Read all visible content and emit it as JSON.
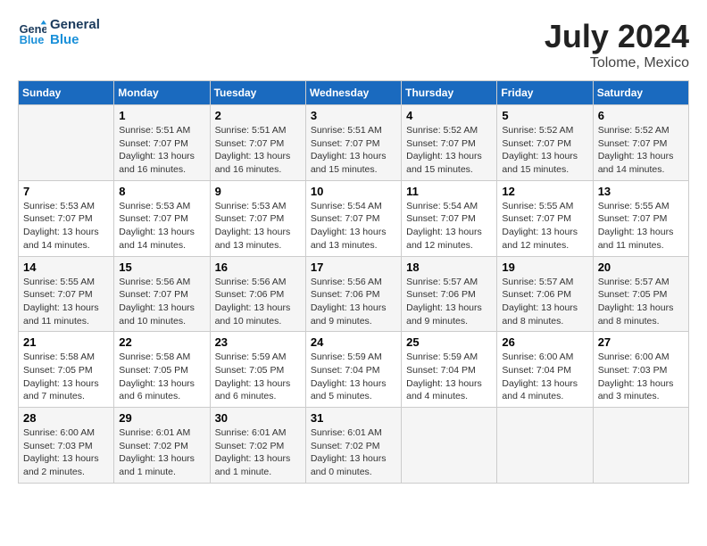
{
  "header": {
    "logo_general": "General",
    "logo_blue": "Blue",
    "month_year": "July 2024",
    "location": "Tolome, Mexico"
  },
  "days_of_week": [
    "Sunday",
    "Monday",
    "Tuesday",
    "Wednesday",
    "Thursday",
    "Friday",
    "Saturday"
  ],
  "weeks": [
    [
      {
        "day": "",
        "sunrise": "",
        "sunset": "",
        "daylight": ""
      },
      {
        "day": "1",
        "sunrise": "Sunrise: 5:51 AM",
        "sunset": "Sunset: 7:07 PM",
        "daylight": "Daylight: 13 hours and 16 minutes."
      },
      {
        "day": "2",
        "sunrise": "Sunrise: 5:51 AM",
        "sunset": "Sunset: 7:07 PM",
        "daylight": "Daylight: 13 hours and 16 minutes."
      },
      {
        "day": "3",
        "sunrise": "Sunrise: 5:51 AM",
        "sunset": "Sunset: 7:07 PM",
        "daylight": "Daylight: 13 hours and 15 minutes."
      },
      {
        "day": "4",
        "sunrise": "Sunrise: 5:52 AM",
        "sunset": "Sunset: 7:07 PM",
        "daylight": "Daylight: 13 hours and 15 minutes."
      },
      {
        "day": "5",
        "sunrise": "Sunrise: 5:52 AM",
        "sunset": "Sunset: 7:07 PM",
        "daylight": "Daylight: 13 hours and 15 minutes."
      },
      {
        "day": "6",
        "sunrise": "Sunrise: 5:52 AM",
        "sunset": "Sunset: 7:07 PM",
        "daylight": "Daylight: 13 hours and 14 minutes."
      }
    ],
    [
      {
        "day": "7",
        "sunrise": "Sunrise: 5:53 AM",
        "sunset": "Sunset: 7:07 PM",
        "daylight": "Daylight: 13 hours and 14 minutes."
      },
      {
        "day": "8",
        "sunrise": "Sunrise: 5:53 AM",
        "sunset": "Sunset: 7:07 PM",
        "daylight": "Daylight: 13 hours and 14 minutes."
      },
      {
        "day": "9",
        "sunrise": "Sunrise: 5:53 AM",
        "sunset": "Sunset: 7:07 PM",
        "daylight": "Daylight: 13 hours and 13 minutes."
      },
      {
        "day": "10",
        "sunrise": "Sunrise: 5:54 AM",
        "sunset": "Sunset: 7:07 PM",
        "daylight": "Daylight: 13 hours and 13 minutes."
      },
      {
        "day": "11",
        "sunrise": "Sunrise: 5:54 AM",
        "sunset": "Sunset: 7:07 PM",
        "daylight": "Daylight: 13 hours and 12 minutes."
      },
      {
        "day": "12",
        "sunrise": "Sunrise: 5:55 AM",
        "sunset": "Sunset: 7:07 PM",
        "daylight": "Daylight: 13 hours and 12 minutes."
      },
      {
        "day": "13",
        "sunrise": "Sunrise: 5:55 AM",
        "sunset": "Sunset: 7:07 PM",
        "daylight": "Daylight: 13 hours and 11 minutes."
      }
    ],
    [
      {
        "day": "14",
        "sunrise": "Sunrise: 5:55 AM",
        "sunset": "Sunset: 7:07 PM",
        "daylight": "Daylight: 13 hours and 11 minutes."
      },
      {
        "day": "15",
        "sunrise": "Sunrise: 5:56 AM",
        "sunset": "Sunset: 7:07 PM",
        "daylight": "Daylight: 13 hours and 10 minutes."
      },
      {
        "day": "16",
        "sunrise": "Sunrise: 5:56 AM",
        "sunset": "Sunset: 7:06 PM",
        "daylight": "Daylight: 13 hours and 10 minutes."
      },
      {
        "day": "17",
        "sunrise": "Sunrise: 5:56 AM",
        "sunset": "Sunset: 7:06 PM",
        "daylight": "Daylight: 13 hours and 9 minutes."
      },
      {
        "day": "18",
        "sunrise": "Sunrise: 5:57 AM",
        "sunset": "Sunset: 7:06 PM",
        "daylight": "Daylight: 13 hours and 9 minutes."
      },
      {
        "day": "19",
        "sunrise": "Sunrise: 5:57 AM",
        "sunset": "Sunset: 7:06 PM",
        "daylight": "Daylight: 13 hours and 8 minutes."
      },
      {
        "day": "20",
        "sunrise": "Sunrise: 5:57 AM",
        "sunset": "Sunset: 7:05 PM",
        "daylight": "Daylight: 13 hours and 8 minutes."
      }
    ],
    [
      {
        "day": "21",
        "sunrise": "Sunrise: 5:58 AM",
        "sunset": "Sunset: 7:05 PM",
        "daylight": "Daylight: 13 hours and 7 minutes."
      },
      {
        "day": "22",
        "sunrise": "Sunrise: 5:58 AM",
        "sunset": "Sunset: 7:05 PM",
        "daylight": "Daylight: 13 hours and 6 minutes."
      },
      {
        "day": "23",
        "sunrise": "Sunrise: 5:59 AM",
        "sunset": "Sunset: 7:05 PM",
        "daylight": "Daylight: 13 hours and 6 minutes."
      },
      {
        "day": "24",
        "sunrise": "Sunrise: 5:59 AM",
        "sunset": "Sunset: 7:04 PM",
        "daylight": "Daylight: 13 hours and 5 minutes."
      },
      {
        "day": "25",
        "sunrise": "Sunrise: 5:59 AM",
        "sunset": "Sunset: 7:04 PM",
        "daylight": "Daylight: 13 hours and 4 minutes."
      },
      {
        "day": "26",
        "sunrise": "Sunrise: 6:00 AM",
        "sunset": "Sunset: 7:04 PM",
        "daylight": "Daylight: 13 hours and 4 minutes."
      },
      {
        "day": "27",
        "sunrise": "Sunrise: 6:00 AM",
        "sunset": "Sunset: 7:03 PM",
        "daylight": "Daylight: 13 hours and 3 minutes."
      }
    ],
    [
      {
        "day": "28",
        "sunrise": "Sunrise: 6:00 AM",
        "sunset": "Sunset: 7:03 PM",
        "daylight": "Daylight: 13 hours and 2 minutes."
      },
      {
        "day": "29",
        "sunrise": "Sunrise: 6:01 AM",
        "sunset": "Sunset: 7:02 PM",
        "daylight": "Daylight: 13 hours and 1 minute."
      },
      {
        "day": "30",
        "sunrise": "Sunrise: 6:01 AM",
        "sunset": "Sunset: 7:02 PM",
        "daylight": "Daylight: 13 hours and 1 minute."
      },
      {
        "day": "31",
        "sunrise": "Sunrise: 6:01 AM",
        "sunset": "Sunset: 7:02 PM",
        "daylight": "Daylight: 13 hours and 0 minutes."
      },
      {
        "day": "",
        "sunrise": "",
        "sunset": "",
        "daylight": ""
      },
      {
        "day": "",
        "sunrise": "",
        "sunset": "",
        "daylight": ""
      },
      {
        "day": "",
        "sunrise": "",
        "sunset": "",
        "daylight": ""
      }
    ]
  ]
}
